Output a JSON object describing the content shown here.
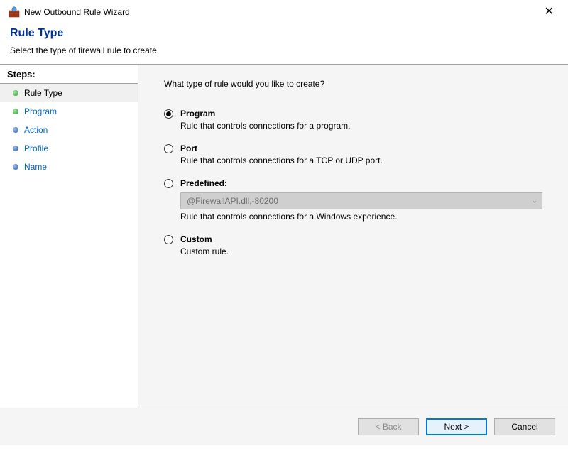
{
  "window": {
    "title": "New Outbound Rule Wizard",
    "close": "✕"
  },
  "header": {
    "title": "Rule Type",
    "subtitle": "Select the type of firewall rule to create."
  },
  "sidebar": {
    "heading": "Steps:",
    "items": [
      {
        "label": "Rule Type"
      },
      {
        "label": "Program"
      },
      {
        "label": "Action"
      },
      {
        "label": "Profile"
      },
      {
        "label": "Name"
      }
    ]
  },
  "content": {
    "question": "What type of rule would you like to create?",
    "options": {
      "program": {
        "label": "Program",
        "desc": "Rule that controls connections for a program."
      },
      "port": {
        "label": "Port",
        "desc": "Rule that controls connections for a TCP or UDP port."
      },
      "predefined": {
        "label": "Predefined:",
        "select_value": "@FirewallAPI.dll,-80200",
        "desc": "Rule that controls connections for a Windows experience."
      },
      "custom": {
        "label": "Custom",
        "desc": "Custom rule."
      }
    }
  },
  "footer": {
    "back": "< Back",
    "next": "Next >",
    "cancel": "Cancel"
  }
}
